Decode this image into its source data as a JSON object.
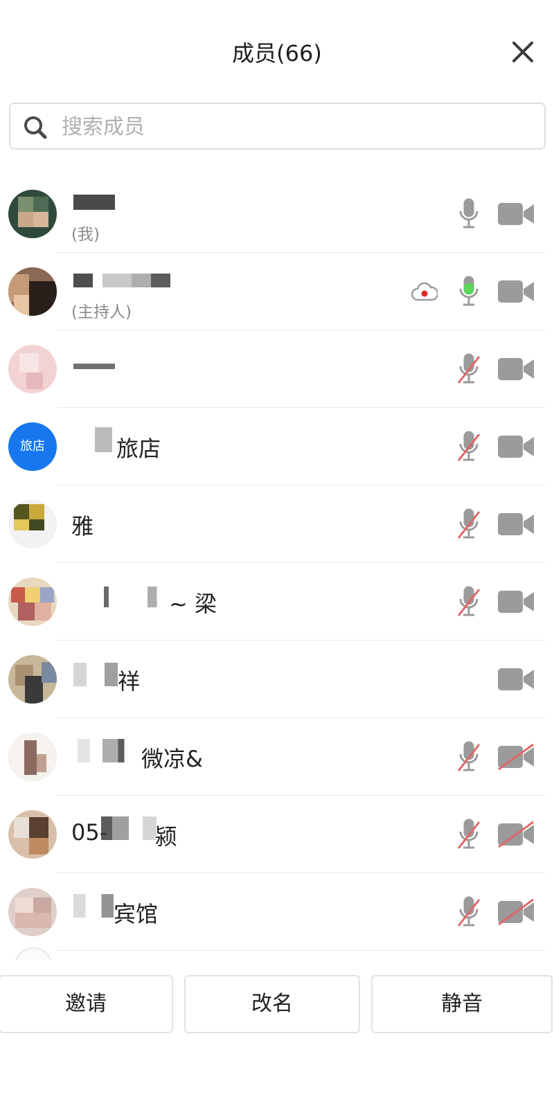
{
  "header": {
    "title": "成员(66)",
    "close_icon": "close-icon"
  },
  "search": {
    "placeholder": "搜索成员",
    "value": "",
    "icon": "search-icon"
  },
  "colors": {
    "mic_active": "#5cd65c",
    "mic_muted_slash": "#e06767",
    "icon_gray": "#9b9b9b",
    "avatar_blue": "#1677ef",
    "recording_dot": "#e02828"
  },
  "members": [
    {
      "name": "",
      "subtitle": "(我)",
      "mic": "on",
      "camera": "off",
      "recording": false
    },
    {
      "name": "",
      "subtitle": "(主持人)",
      "mic": "active",
      "camera": "off",
      "recording": true
    },
    {
      "name": "",
      "subtitle": "",
      "mic": "muted",
      "camera": "off",
      "recording": false
    },
    {
      "name": "旅店",
      "subtitle": "",
      "avatar_text": "旅店",
      "mic": "muted",
      "camera": "off",
      "recording": false
    },
    {
      "name": "雅",
      "subtitle": "",
      "mic": "muted",
      "camera": "off",
      "recording": false
    },
    {
      "name": "~ 梁",
      "subtitle": "",
      "mic": "muted",
      "camera": "off",
      "recording": false
    },
    {
      "name": "祥",
      "subtitle": "",
      "mic": "none",
      "camera": "off",
      "recording": false
    },
    {
      "name": "微凉&",
      "subtitle": "",
      "mic": "muted",
      "camera": "disabled",
      "recording": false
    },
    {
      "name": "05-",
      "name_tail": "颍",
      "subtitle": "",
      "mic": "muted",
      "camera": "disabled",
      "recording": false
    },
    {
      "name": "宾馆",
      "subtitle": "",
      "mic": "muted",
      "camera": "disabled",
      "recording": false
    }
  ],
  "actions": {
    "invite": "邀请",
    "rename": "改名",
    "mute": "静音"
  }
}
